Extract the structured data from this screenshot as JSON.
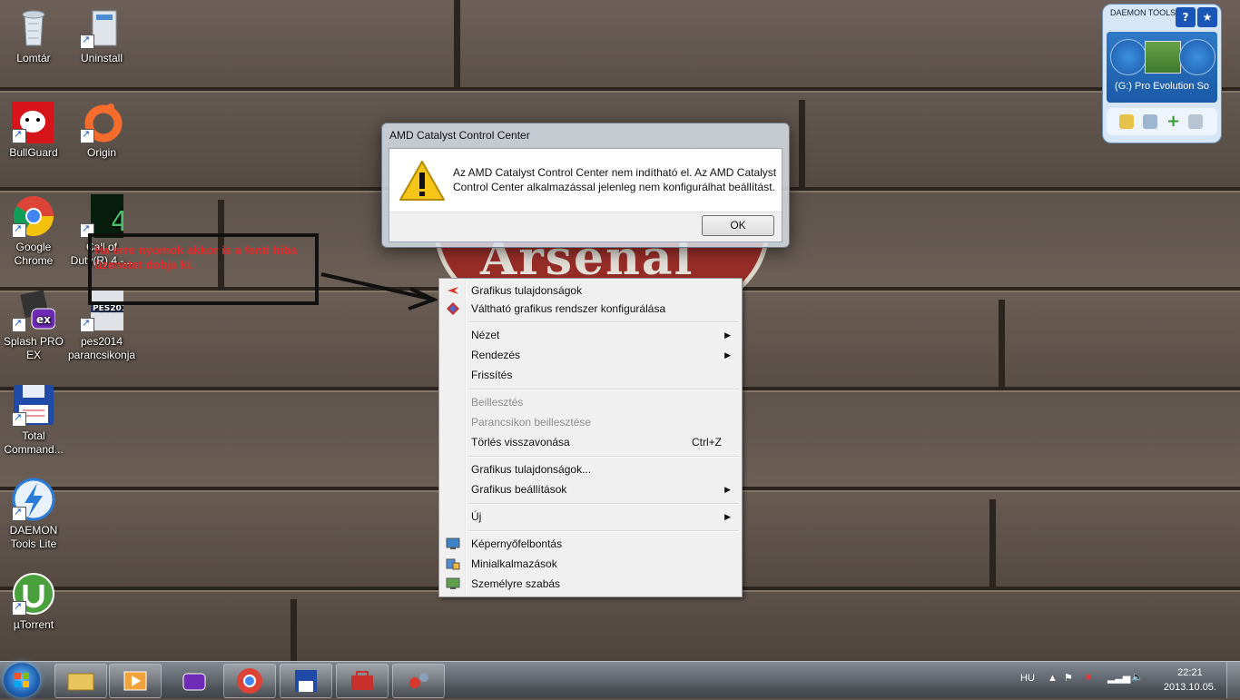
{
  "desktop": {
    "icons": [
      {
        "label": "Lomtár"
      },
      {
        "label": "Uninstall"
      },
      {
        "label": "BullGuard"
      },
      {
        "label": "Origin"
      },
      {
        "label": "Google Chrome"
      },
      {
        "label": "Call of Duty(R) 4 -..."
      },
      {
        "label": "Splash PRO EX"
      },
      {
        "label": "pes2014 parancsikonja"
      },
      {
        "label": "Total Command..."
      },
      {
        "label": "DAEMON Tools Lite"
      },
      {
        "label": "µTorrent"
      }
    ],
    "wallpaper_text": "Arsenal",
    "annotation": "Ha erre nyomok akkor is a fenti hiba üzenetet dobja ki."
  },
  "dialog": {
    "title": "AMD Catalyst Control Center",
    "message": "Az AMD Catalyst Control Center nem indítható el. Az AMD Catalyst Control Center alkalmazással jelenleg nem konfigurálhat beállítást.",
    "ok_label": "OK"
  },
  "context_menu": {
    "items": [
      {
        "label": "Grafikus tulajdonságok",
        "icon": "amd-icon"
      },
      {
        "label": "Váltható grafikus rendszer konfigurálása",
        "icon": "switchable-graphics-icon"
      },
      {
        "label": "Nézet",
        "submenu": true
      },
      {
        "label": "Rendezés",
        "submenu": true
      },
      {
        "label": "Frissítés"
      },
      {
        "label": "Beillesztés",
        "disabled": true
      },
      {
        "label": "Parancsikon beillesztése",
        "disabled": true
      },
      {
        "label": "Törlés visszavonása",
        "shortcut": "Ctrl+Z"
      },
      {
        "label": "Grafikus tulajdonságok..."
      },
      {
        "label": "Grafikus beállítások",
        "submenu": true
      },
      {
        "label": "Új",
        "submenu": true
      },
      {
        "label": "Képernyőfelbontás",
        "icon": "display-icon"
      },
      {
        "label": "Minialkalmazások",
        "icon": "gadgets-icon"
      },
      {
        "label": "Személyre szabás",
        "icon": "personalize-icon"
      }
    ]
  },
  "daemon_gadget": {
    "logo": "DAEMON TOOLS",
    "help_label": "?",
    "drive_label": "(G:) Pro Evolution So"
  },
  "taskbar": {
    "language": "HU",
    "time": "22:21",
    "date": "2013.10.05."
  }
}
